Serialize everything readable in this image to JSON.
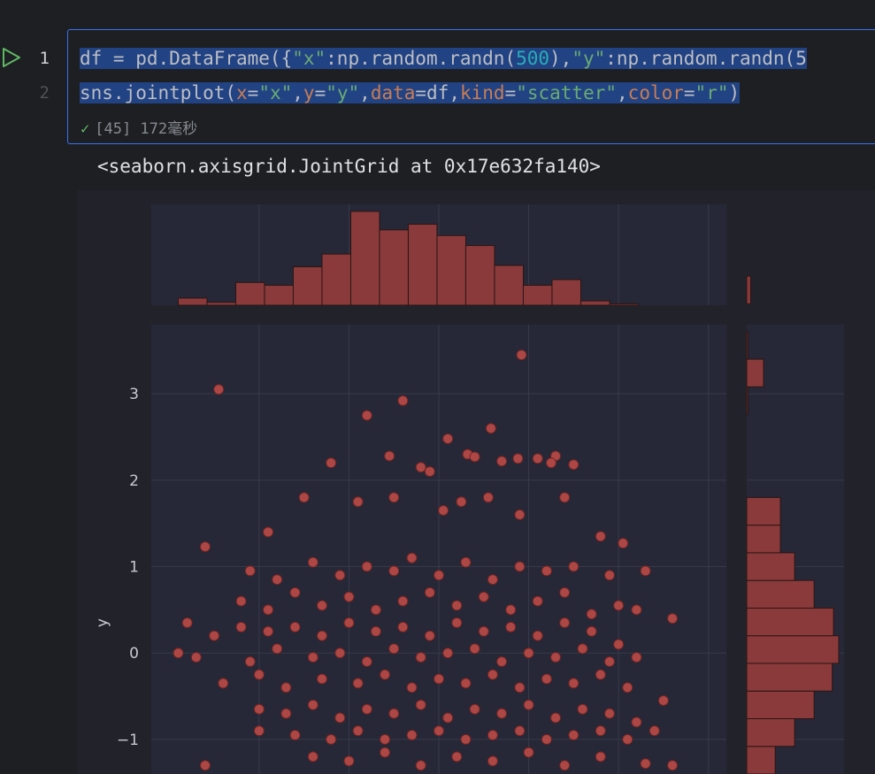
{
  "gutter": {
    "line1": "1",
    "line2": "2"
  },
  "code": {
    "line1": [
      {
        "t": "df = pd.DataFrame({",
        "c": ""
      },
      {
        "t": "\"x\"",
        "c": "t-str"
      },
      {
        "t": ":np.random.randn(",
        "c": ""
      },
      {
        "t": "500",
        "c": "t-num"
      },
      {
        "t": "),",
        "c": ""
      },
      {
        "t": "\"y\"",
        "c": "t-str"
      },
      {
        "t": ":np.random.randn(5",
        "c": ""
      }
    ],
    "line2": [
      {
        "t": "sns.jointplot(",
        "c": ""
      },
      {
        "t": "x",
        "c": "t-kw"
      },
      {
        "t": "=",
        "c": ""
      },
      {
        "t": "\"x\"",
        "c": "t-str"
      },
      {
        "t": ",",
        "c": ""
      },
      {
        "t": "y",
        "c": "t-kw"
      },
      {
        "t": "=",
        "c": ""
      },
      {
        "t": "\"y\"",
        "c": "t-str"
      },
      {
        "t": ",",
        "c": ""
      },
      {
        "t": "data",
        "c": "t-kw"
      },
      {
        "t": "=df,",
        "c": ""
      },
      {
        "t": "kind",
        "c": "t-kw"
      },
      {
        "t": "=",
        "c": ""
      },
      {
        "t": "\"scatter\"",
        "c": "t-str"
      },
      {
        "t": ",",
        "c": ""
      },
      {
        "t": "color",
        "c": "t-kw"
      },
      {
        "t": "=",
        "c": ""
      },
      {
        "t": "\"r\"",
        "c": "t-str"
      },
      {
        "t": ")",
        "c": ""
      }
    ]
  },
  "execution": {
    "check": "✓",
    "text": "[45] 172毫秒"
  },
  "output": {
    "repr": "<seaborn.axisgrid.JointGrid at 0x17e632fa140>"
  },
  "colors": {
    "accent": "#3574f0",
    "marker_fill": "#b84a48",
    "marker_edge": "#6e2523",
    "bar_fill": "#8a3a3a",
    "bar_edge": "#2a1515",
    "plot_bg": "#262837"
  },
  "icons": {
    "run": "play-icon",
    "check": "check-icon"
  },
  "chart_data": {
    "type": "scatter",
    "title": "",
    "xlabel": "",
    "ylabel": "y",
    "ylim": [
      -1.4,
      3.8
    ],
    "xlim": [
      -3.2,
      3.2
    ],
    "yticks": [
      3,
      2,
      1,
      0,
      -1
    ],
    "ytick_labels": [
      "3",
      "2",
      "1",
      "0",
      "−1"
    ],
    "grid": true,
    "marginal_x": {
      "type": "histogram",
      "bin_start": -2.9,
      "bin_width": 0.32,
      "counts": [
        5,
        2,
        16,
        14,
        27,
        36,
        66,
        53,
        57,
        49,
        42,
        28,
        14,
        18,
        3,
        1
      ]
    },
    "marginal_y": {
      "type": "histogram",
      "bin_start": -1.4,
      "bin_width": 0.32,
      "counts": [
        22,
        37,
        52,
        66,
        71,
        67,
        52,
        37,
        26,
        26,
        0,
        0,
        0,
        1,
        13,
        1,
        0,
        3
      ],
      "visible_bins_from_top": true
    },
    "series": [
      {
        "x": [
          0.92,
          -2.45,
          -0.4,
          -0.8,
          0.58
        ],
        "y": [
          3.45,
          3.05,
          2.92,
          2.75,
          2.6
        ]
      },
      {
        "x": [
          0.1,
          0.32,
          -1.2,
          1.5,
          1.1,
          -0.55,
          -0.2,
          0.4,
          -0.1,
          1.3,
          1.25,
          0.7,
          0.88
        ],
        "y": [
          2.48,
          2.3,
          2.2,
          2.18,
          2.25,
          2.28,
          2.15,
          2.27,
          2.1,
          2.28,
          2.2,
          2.22,
          2.25
        ]
      },
      {
        "x": [
          -2.6,
          -1.5,
          -0.9,
          -0.5,
          0.05,
          0.25,
          0.55,
          0.9,
          1.4,
          1.8,
          2.05,
          -1.9
        ],
        "y": [
          1.23,
          1.8,
          1.75,
          1.8,
          1.65,
          1.75,
          1.8,
          1.6,
          1.8,
          1.35,
          1.27,
          1.4
        ]
      },
      {
        "x": [
          -2.1,
          -1.8,
          -1.4,
          -1.1,
          -0.8,
          -0.5,
          -0.3,
          0.0,
          0.3,
          0.6,
          0.9,
          1.2,
          1.5,
          1.9,
          2.3,
          2.6
        ],
        "y": [
          0.95,
          0.85,
          1.05,
          0.9,
          1.0,
          0.95,
          1.1,
          0.9,
          1.05,
          0.85,
          1.0,
          0.95,
          1.0,
          0.9,
          0.95,
          0.4
        ]
      },
      {
        "x": [
          -2.2,
          -1.9,
          -1.6,
          -1.3,
          -1.0,
          -0.7,
          -0.4,
          -0.1,
          0.2,
          0.5,
          0.8,
          1.1,
          1.4,
          1.7,
          2.0,
          2.2
        ],
        "y": [
          0.6,
          0.5,
          0.7,
          0.55,
          0.65,
          0.5,
          0.6,
          0.7,
          0.55,
          0.65,
          0.5,
          0.6,
          0.7,
          0.45,
          0.55,
          0.5
        ]
      },
      {
        "x": [
          -2.8,
          -2.5,
          -2.2,
          -1.9,
          -1.6,
          -1.3,
          -1.0,
          -0.7,
          -0.4,
          -0.1,
          0.2,
          0.5,
          0.8,
          1.1,
          1.4,
          1.7,
          2.0
        ],
        "y": [
          0.35,
          0.2,
          0.3,
          0.25,
          0.3,
          0.2,
          0.35,
          0.25,
          0.3,
          0.2,
          0.35,
          0.25,
          0.3,
          0.2,
          0.35,
          0.25,
          0.1
        ]
      },
      {
        "x": [
          -2.9,
          -2.7,
          -2.1,
          -1.8,
          -1.4,
          -1.1,
          -0.8,
          -0.5,
          -0.2,
          0.1,
          0.4,
          0.7,
          1.0,
          1.3,
          1.6,
          1.9,
          2.2
        ],
        "y": [
          0.0,
          -0.05,
          -0.1,
          0.05,
          -0.05,
          0.0,
          -0.1,
          0.05,
          -0.05,
          0.0,
          0.05,
          -0.1,
          0.0,
          -0.05,
          0.05,
          -0.1,
          -0.05
        ]
      },
      {
        "x": [
          -2.4,
          -2.0,
          -1.7,
          -1.3,
          -0.9,
          -0.6,
          -0.3,
          0.0,
          0.3,
          0.6,
          0.9,
          1.2,
          1.5,
          1.8,
          2.1,
          2.5
        ],
        "y": [
          -0.35,
          -0.25,
          -0.4,
          -0.3,
          -0.35,
          -0.25,
          -0.4,
          -0.3,
          -0.35,
          -0.25,
          -0.4,
          -0.3,
          -0.35,
          -0.25,
          -0.4,
          -0.55
        ]
      },
      {
        "x": [
          -2.0,
          -1.7,
          -1.4,
          -1.1,
          -0.8,
          -0.5,
          -0.2,
          0.1,
          0.4,
          0.7,
          1.0,
          1.3,
          1.6,
          1.9,
          2.2
        ],
        "y": [
          -0.65,
          -0.7,
          -0.6,
          -0.75,
          -0.65,
          -0.7,
          -0.6,
          -0.75,
          -0.65,
          -0.7,
          -0.6,
          -0.75,
          -0.65,
          -0.7,
          -0.8
        ]
      },
      {
        "x": [
          -2.0,
          -1.6,
          -1.2,
          -0.9,
          -0.6,
          -0.3,
          0.0,
          0.3,
          0.6,
          0.9,
          1.2,
          1.5,
          1.8,
          2.1,
          2.4
        ],
        "y": [
          -0.9,
          -0.95,
          -1.0,
          -0.9,
          -1.0,
          -0.95,
          -0.9,
          -1.0,
          -0.95,
          -0.9,
          -1.0,
          -0.95,
          -0.9,
          -1.0,
          -0.9
        ]
      },
      {
        "x": [
          -2.6,
          -1.4,
          -1.0,
          -0.6,
          -0.2,
          0.2,
          0.6,
          1.0,
          1.4,
          1.8,
          2.3,
          2.6
        ],
        "y": [
          -1.3,
          -1.2,
          -1.25,
          -1.15,
          -1.3,
          -1.2,
          -1.25,
          -1.15,
          -1.3,
          -1.2,
          -1.28,
          -1.3
        ]
      }
    ]
  }
}
